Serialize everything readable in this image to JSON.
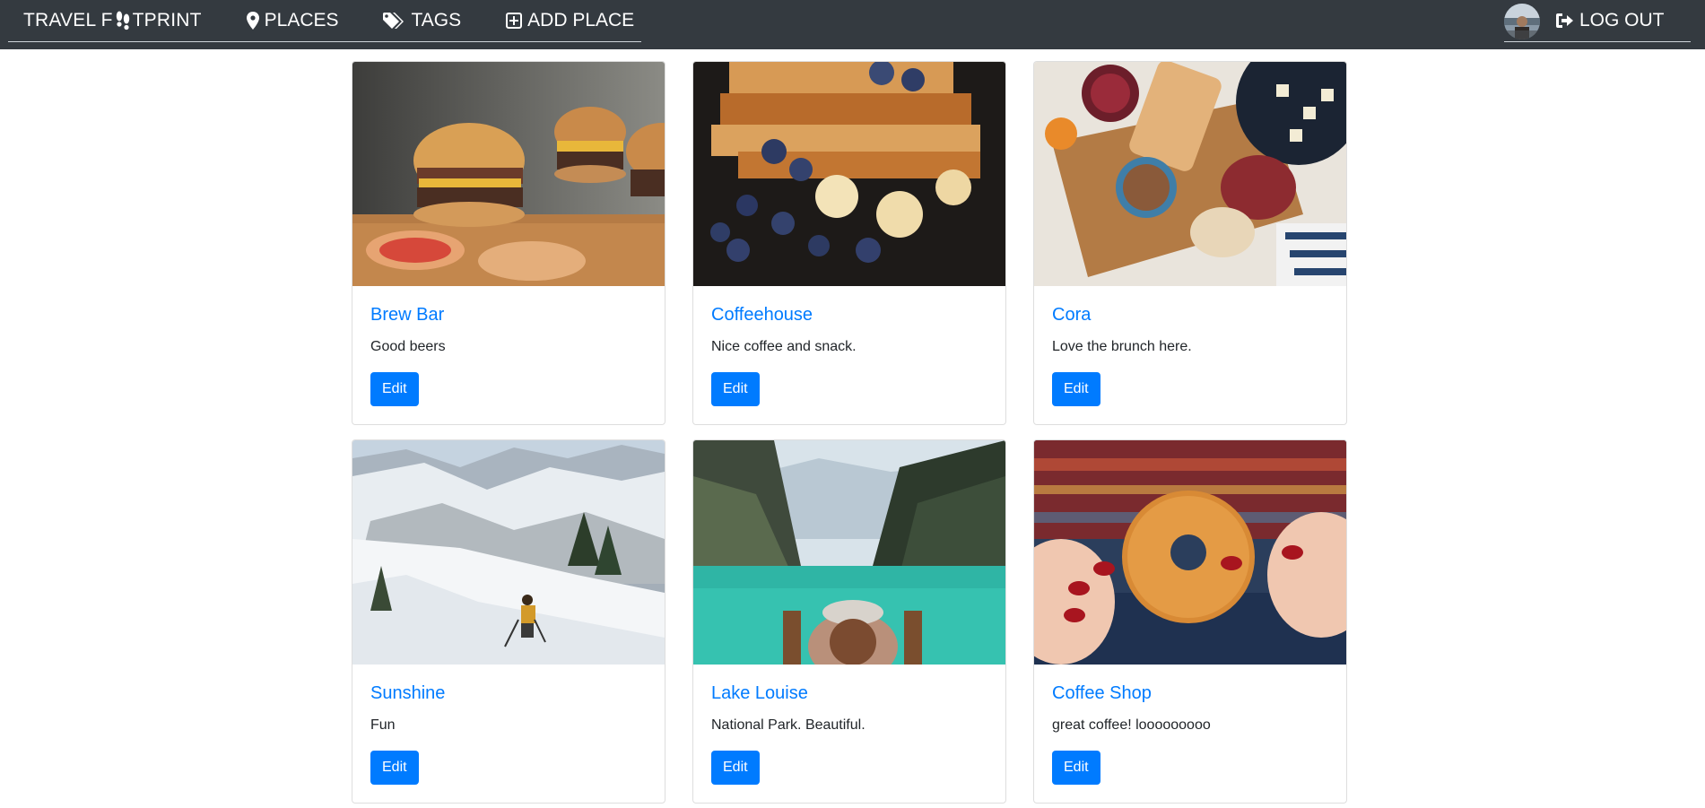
{
  "nav": {
    "brand_prefix": "TRAVEL F",
    "brand_suffix": "TPRINT",
    "places": "PLACES",
    "tags": "TAGS",
    "add_place": "ADD PLACE",
    "logout": "LOG OUT"
  },
  "colors": {
    "navbar": "#343a40",
    "link": "#007bff",
    "button": "#007bff"
  },
  "cards": [
    {
      "title": "Brew Bar",
      "text": "Good beers",
      "button": "Edit",
      "image": "burgers-photo"
    },
    {
      "title": "Coffeehouse",
      "text": "Nice coffee and snack.",
      "button": "Edit",
      "image": "french-toast-photo"
    },
    {
      "title": "Cora",
      "text": "Love the brunch here.",
      "button": "Edit",
      "image": "charcuterie-photo"
    },
    {
      "title": "Sunshine",
      "text": "Fun",
      "button": "Edit",
      "image": "skier-photo"
    },
    {
      "title": "Lake Louise",
      "text": "National Park. Beautiful.",
      "button": "Edit",
      "image": "lake-photo"
    },
    {
      "title": "Coffee Shop",
      "text": "great coffee! looooooooo",
      "button": "Edit",
      "image": "donut-photo"
    }
  ]
}
